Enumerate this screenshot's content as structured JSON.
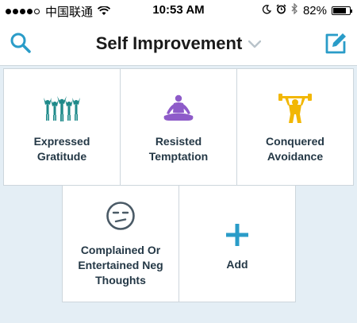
{
  "status_bar": {
    "carrier": "中国联通",
    "time": "10:53 AM",
    "battery": "82%",
    "battery_level": 0.82,
    "signal_bars": 4
  },
  "nav": {
    "title": "Self Improvement",
    "left_icon": "search-icon",
    "right_icon": "compose-icon",
    "title_icon": "chevron-down-icon"
  },
  "tiles": [
    {
      "label": "Expressed\nGratitude",
      "icon": "gratitude-icon",
      "color": "#1f8a8a"
    },
    {
      "label": "Resisted\nTemptation",
      "icon": "meditation-icon",
      "color": "#8e5bc9"
    },
    {
      "label": "Conquered\nAvoidance",
      "icon": "weightlifter-icon",
      "color": "#f2b705"
    },
    {
      "label": "Complained Or\nEntertained Neg\nThoughts",
      "icon": "unamused-face-icon",
      "color": "#4a5a66"
    },
    {
      "label": "Add",
      "icon": "plus-icon",
      "color": "#2a9cc8"
    }
  ],
  "colors": {
    "accent": "#2a9cc8",
    "background": "#e4eef5"
  }
}
